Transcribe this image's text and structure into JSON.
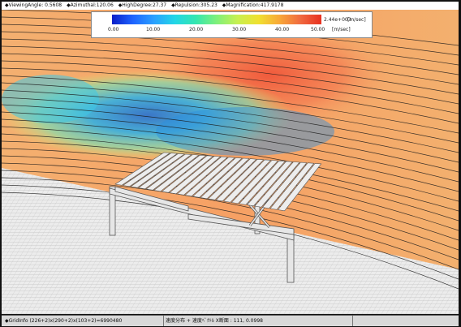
{
  "header": {
    "viewing_angle": "◆ViewingAngle: 0.5608",
    "azimuthal": "◆Azimuthal:120.06",
    "high_degree": "◆HighDegree:27.37",
    "repulsion": "◆Repulsion:305.23",
    "magnification": "◆Magnification:417.9178"
  },
  "legend": {
    "ticks": [
      "0.00",
      "10.00",
      "20.00",
      "30.00",
      "40.00",
      "50.00"
    ],
    "max_value": "2.44e+003",
    "unit_top": "[m/sec]",
    "unit_bottom": "[m/sec]",
    "colors": [
      "#0a1ec8",
      "#1e64ff",
      "#2aa0ff",
      "#22d6e6",
      "#34e6b0",
      "#7ff07a",
      "#c8f050",
      "#f0e030",
      "#f8a838",
      "#f06a40",
      "#e83020"
    ]
  },
  "footer": {
    "grid_info": "◆GridInfo  (226+2)x(290+2)x(103+2)=6990480",
    "section_info": "速度分布 + 速度ﾍﾞｸﾄﾙ X断面 : 111,  0.0998"
  }
}
